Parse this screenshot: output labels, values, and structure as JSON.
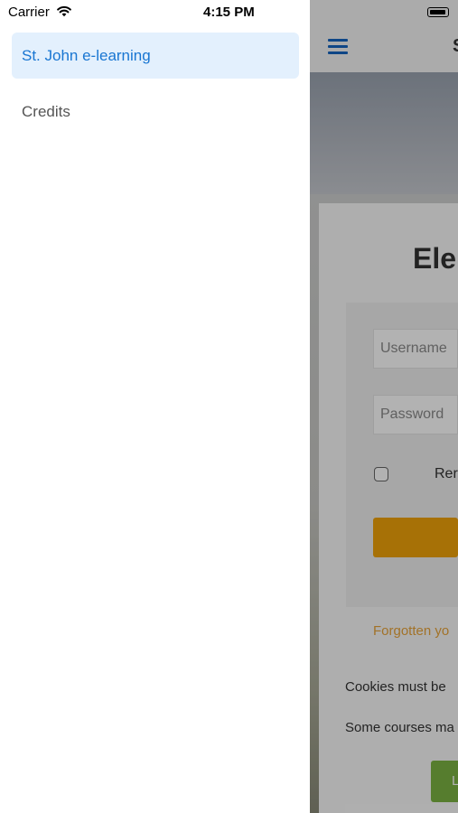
{
  "status_bar": {
    "carrier": "Carrier",
    "time": "4:15 PM",
    "wifi_icon": "wifi-icon",
    "battery_icon": "battery-icon"
  },
  "drawer": {
    "items": [
      {
        "label": "St. John e-learning",
        "active": true
      },
      {
        "label": "Credits",
        "active": false
      }
    ],
    "active_color": "#1976d2",
    "active_bg": "#e3f0fd"
  },
  "background_page": {
    "menu_icon": "hamburger-icon",
    "title_partial": "S",
    "heading_partial": "Ele",
    "username_placeholder": "Username",
    "password_placeholder": "Password",
    "remember_partial": "Rer",
    "forgot_partial": "Forgotten yo",
    "cookies_partial": "Cookies must be",
    "courses_partial": "Some courses ma",
    "guest_partial": "L",
    "login_button_color": "#f0a30a",
    "guest_button_color": "#7cb342"
  }
}
